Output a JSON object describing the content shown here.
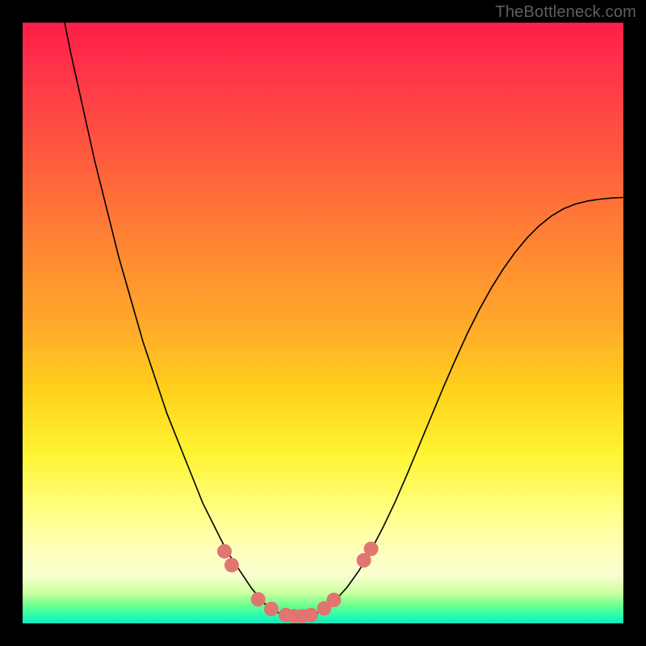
{
  "watermark": "TheBottleneck.com",
  "chart_data": {
    "type": "line",
    "title": "",
    "xlabel": "",
    "ylabel": "",
    "x": [
      0.0,
      0.02,
      0.04,
      0.06,
      0.08,
      0.1,
      0.12,
      0.14,
      0.16,
      0.18,
      0.2,
      0.22,
      0.24,
      0.26,
      0.28,
      0.3,
      0.32,
      0.34,
      0.36,
      0.38,
      0.4,
      0.42,
      0.44,
      0.46,
      0.48,
      0.5,
      0.52,
      0.54,
      0.56,
      0.58,
      0.6,
      0.62,
      0.64,
      0.66,
      0.68,
      0.7,
      0.72,
      0.74,
      0.76,
      0.78,
      0.8,
      0.82,
      0.84,
      0.86,
      0.88,
      0.9,
      0.92,
      0.94,
      0.96,
      0.98,
      1.0
    ],
    "values": [
      1.4,
      1.28,
      1.16,
      1.05,
      0.95,
      0.86,
      0.77,
      0.69,
      0.61,
      0.54,
      0.47,
      0.41,
      0.35,
      0.3,
      0.25,
      0.2,
      0.16,
      0.12,
      0.09,
      0.06,
      0.035,
      0.02,
      0.012,
      0.01,
      0.013,
      0.022,
      0.038,
      0.06,
      0.088,
      0.122,
      0.16,
      0.202,
      0.248,
      0.296,
      0.344,
      0.392,
      0.438,
      0.482,
      0.522,
      0.558,
      0.59,
      0.618,
      0.642,
      0.662,
      0.678,
      0.69,
      0.698,
      0.703,
      0.706,
      0.708,
      0.709
    ],
    "xlim": [
      0,
      1
    ],
    "ylim": [
      0,
      1
    ],
    "grid": false,
    "legend_position": "none",
    "markers": [
      {
        "x": 0.336,
        "y": 0.12
      },
      {
        "x": 0.348,
        "y": 0.097
      },
      {
        "x": 0.392,
        "y": 0.04
      },
      {
        "x": 0.414,
        "y": 0.024
      },
      {
        "x": 0.438,
        "y": 0.014
      },
      {
        "x": 0.452,
        "y": 0.012
      },
      {
        "x": 0.466,
        "y": 0.012
      },
      {
        "x": 0.48,
        "y": 0.014
      },
      {
        "x": 0.502,
        "y": 0.025
      },
      {
        "x": 0.518,
        "y": 0.039
      },
      {
        "x": 0.568,
        "y": 0.105
      },
      {
        "x": 0.58,
        "y": 0.124
      }
    ],
    "gradient_stops": [
      {
        "pos": 0.0,
        "color": "#ff1d48"
      },
      {
        "pos": 0.5,
        "color": "#ffa82a"
      },
      {
        "pos": 0.72,
        "color": "#fff433"
      },
      {
        "pos": 0.92,
        "color": "#f8ffcf"
      },
      {
        "pos": 1.0,
        "color": "#16e7c0"
      }
    ]
  }
}
